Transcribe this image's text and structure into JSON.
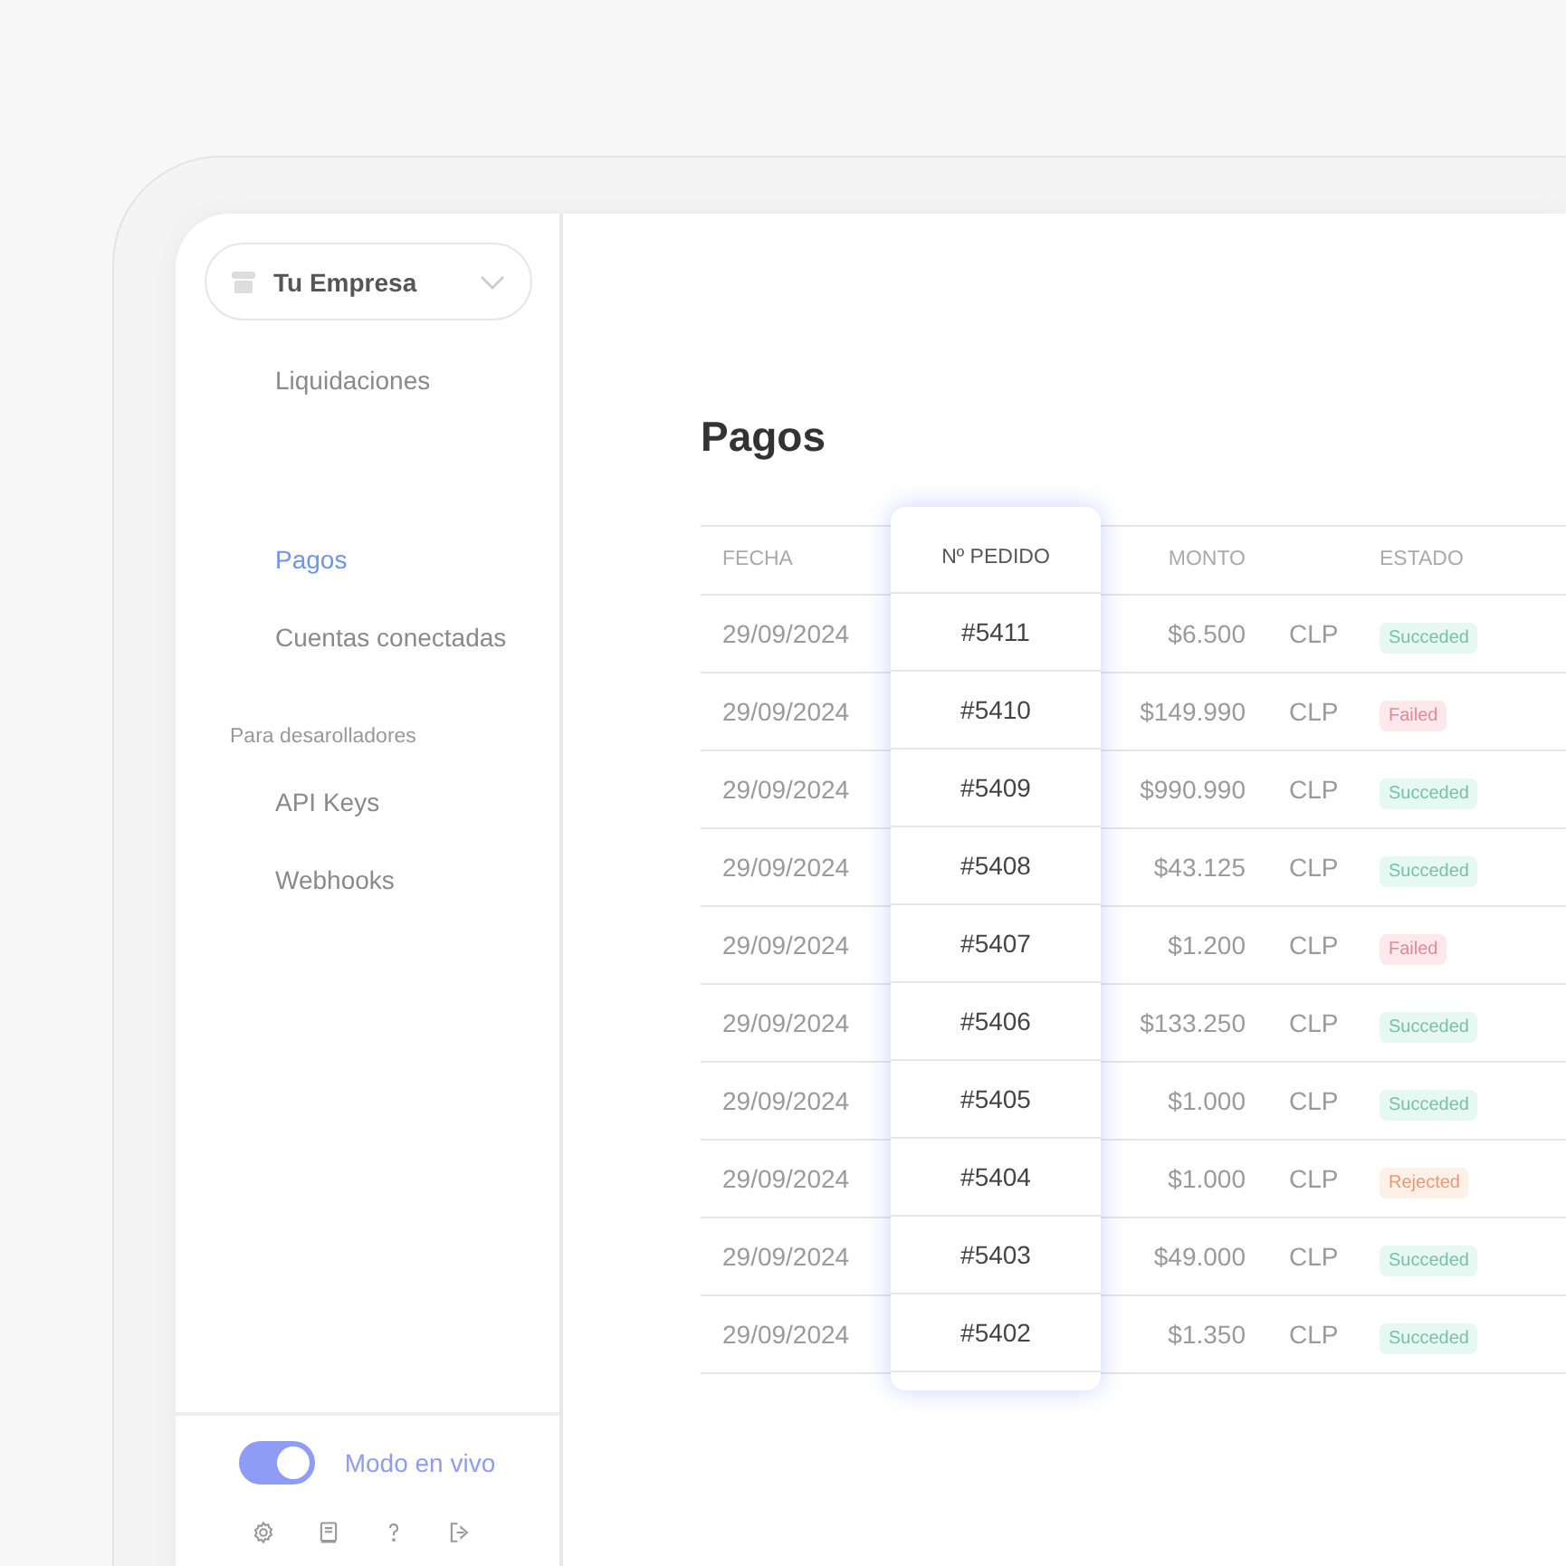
{
  "company": {
    "name": "Tu Empresa"
  },
  "nav_groups": [
    {
      "items": [
        {
          "label": "Liquidaciones",
          "selected": false
        }
      ]
    },
    {
      "items": [
        {
          "label": "Pagos",
          "selected": true
        },
        {
          "label": "Cuentas conectadas",
          "selected": false
        }
      ]
    }
  ],
  "dev_section": {
    "title": "Para desarolladores",
    "items": [
      {
        "label": "API Keys",
        "selected": false
      },
      {
        "label": "Webhooks",
        "selected": false
      }
    ]
  },
  "live_mode": {
    "label": "Modo en vivo",
    "on": true
  },
  "page_title": "Pagos",
  "table": {
    "columns": [
      "FECHA",
      "Nº PEDIDO",
      "MONTO",
      "ESTADO"
    ],
    "rows": [
      {
        "date": "29/09/2024",
        "order": "#5411",
        "amount": "$6.500",
        "currency": "CLP",
        "status": {
          "label": "Succeded",
          "kind": "success"
        }
      },
      {
        "date": "29/09/2024",
        "order": "#5410",
        "amount": "$149.990",
        "currency": "CLP",
        "status": {
          "label": "Failed",
          "kind": "failed"
        }
      },
      {
        "date": "29/09/2024",
        "order": "#5409",
        "amount": "$990.990",
        "currency": "CLP",
        "status": {
          "label": "Succeded",
          "kind": "success"
        }
      },
      {
        "date": "29/09/2024",
        "order": "#5408",
        "amount": "$43.125",
        "currency": "CLP",
        "status": {
          "label": "Succeded",
          "kind": "success"
        }
      },
      {
        "date": "29/09/2024",
        "order": "#5407",
        "amount": "$1.200",
        "currency": "CLP",
        "status": {
          "label": "Failed",
          "kind": "failed"
        }
      },
      {
        "date": "29/09/2024",
        "order": "#5406",
        "amount": "$133.250",
        "currency": "CLP",
        "status": {
          "label": "Succeded",
          "kind": "success"
        }
      },
      {
        "date": "29/09/2024",
        "order": "#5405",
        "amount": "$1.000",
        "currency": "CLP",
        "status": {
          "label": "Succeded",
          "kind": "success"
        }
      },
      {
        "date": "29/09/2024",
        "order": "#5404",
        "amount": "$1.000",
        "currency": "CLP",
        "status": {
          "label": "Rejected",
          "kind": "rejected"
        }
      },
      {
        "date": "29/09/2024",
        "order": "#5403",
        "amount": "$49.000",
        "currency": "CLP",
        "status": {
          "label": "Succeded",
          "kind": "success"
        }
      },
      {
        "date": "29/09/2024",
        "order": "#5402",
        "amount": "$1.350",
        "currency": "CLP",
        "status": {
          "label": "Succeded",
          "kind": "success"
        }
      }
    ]
  }
}
